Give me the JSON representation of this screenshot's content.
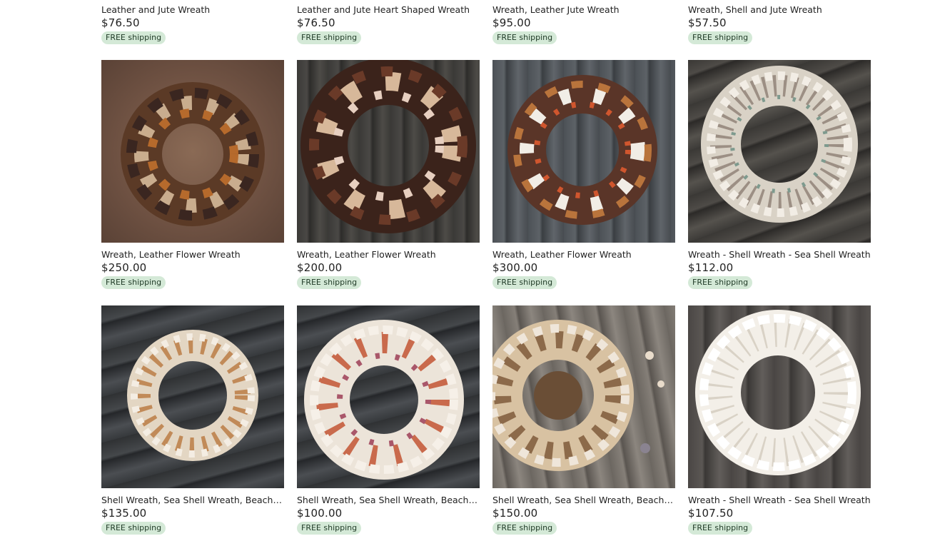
{
  "top_row": [
    {
      "title": "Leather and Jute Wreath",
      "price": "$76.50",
      "badge": "FREE shipping"
    },
    {
      "title": "Leather and Jute Heart Shaped Wreath",
      "price": "$76.50",
      "badge": "FREE shipping"
    },
    {
      "title": "Wreath, Leather Jute Wreath",
      "price": "$95.00",
      "badge": "FREE shipping"
    },
    {
      "title": "Wreath, Shell and Jute Wreath",
      "price": "$57.50",
      "badge": "FREE shipping"
    }
  ],
  "row_2": [
    {
      "title": "Wreath, Leather Flower Wreath",
      "price": "$250.00",
      "badge": "FREE shipping",
      "image": "leather-flower-wreath-brown-backdrop"
    },
    {
      "title": "Wreath, Leather Flower Wreath",
      "price": "$200.00",
      "badge": "FREE shipping",
      "image": "leather-flower-wreath-dark-wood"
    },
    {
      "title": "Wreath, Leather Flower Wreath",
      "price": "$300.00",
      "badge": "FREE shipping",
      "image": "leather-flower-wreath-grey-wood"
    },
    {
      "title": "Wreath - Shell Wreath - Sea Shell Wreath",
      "price": "$112.00",
      "badge": "FREE shipping",
      "image": "sea-shell-wreath-grey-wood"
    }
  ],
  "row_3": [
    {
      "title": "Shell Wreath, Sea Shell Wreath, Beach Wreath",
      "price": "$135.00",
      "badge": "FREE shipping",
      "image": "shell-wreath-diagonal-wood"
    },
    {
      "title": "Shell Wreath, Sea Shell Wreath, Beach Wreath",
      "price": "$100.00",
      "badge": "FREE shipping",
      "image": "scallop-shell-wreath"
    },
    {
      "title": "Shell Wreath, Sea Shell Wreath, Beach Wreath",
      "price": "$150.00",
      "badge": "FREE shipping",
      "image": "mixed-shell-wreath-light-wood"
    },
    {
      "title": "Wreath - Shell Wreath - Sea Shell Wreath",
      "price": "$107.50",
      "badge": "FREE shipping",
      "image": "white-cockle-shell-wreath"
    }
  ],
  "colors": {
    "badge_bg": "#d4e9d7",
    "badge_text": "#1f3a26",
    "text": "#222222"
  }
}
